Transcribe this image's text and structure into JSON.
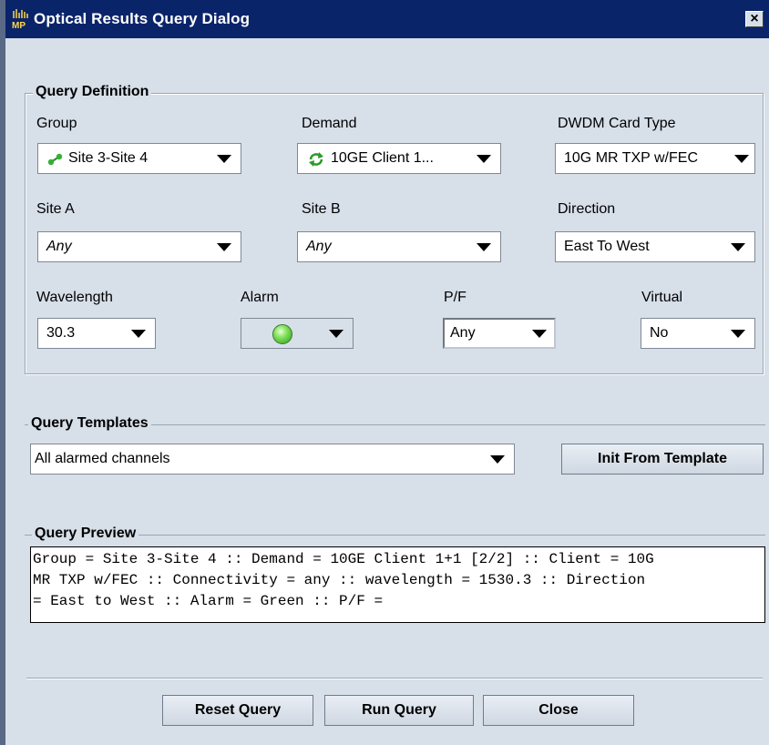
{
  "window": {
    "title": "Optical Results Query Dialog",
    "icon": "mp-app-icon",
    "close_label": "×"
  },
  "query_definition": {
    "title": "Query Definition",
    "group": {
      "label": "Group",
      "value": "Site 3-Site 4",
      "icon": "link-icon"
    },
    "demand": {
      "label": "Demand",
      "value": "10GE Client 1...",
      "icon": "cycle-icon"
    },
    "dwdm_card_type": {
      "label": "DWDM Card Type",
      "value": "10G MR TXP w/FEC"
    },
    "site_a": {
      "label": "Site A",
      "value": "Any"
    },
    "site_b": {
      "label": "Site B",
      "value": "Any"
    },
    "direction": {
      "label": "Direction",
      "value": "East To West"
    },
    "wavelength": {
      "label": "Wavelength",
      "value": "30.3"
    },
    "alarm": {
      "label": "Alarm",
      "value_color": "#6fd84a"
    },
    "pf": {
      "label": "P/F",
      "value": "Any"
    },
    "virtual": {
      "label": "Virtual",
      "value": "No"
    }
  },
  "query_templates": {
    "title": "Query Templates",
    "selected": "All alarmed channels",
    "init_button": "Init From Template"
  },
  "query_preview": {
    "title": "Query Preview",
    "lines": [
      "Group = Site 3-Site 4 :: Demand = 10GE Client 1+1 [2/2] :: Client = 10G",
      "MR TXP w/FEC :: Connectivity = any :: wavelength = 1530.3 :: Direction",
      "= East to West :: Alarm = Green :: P/F ="
    ]
  },
  "footer": {
    "reset_button": "Reset Query",
    "run_button": "Run Query",
    "close_button": "Close"
  },
  "colors": {
    "titlebar": "#0a246a",
    "panel": "#d7dfe9"
  }
}
